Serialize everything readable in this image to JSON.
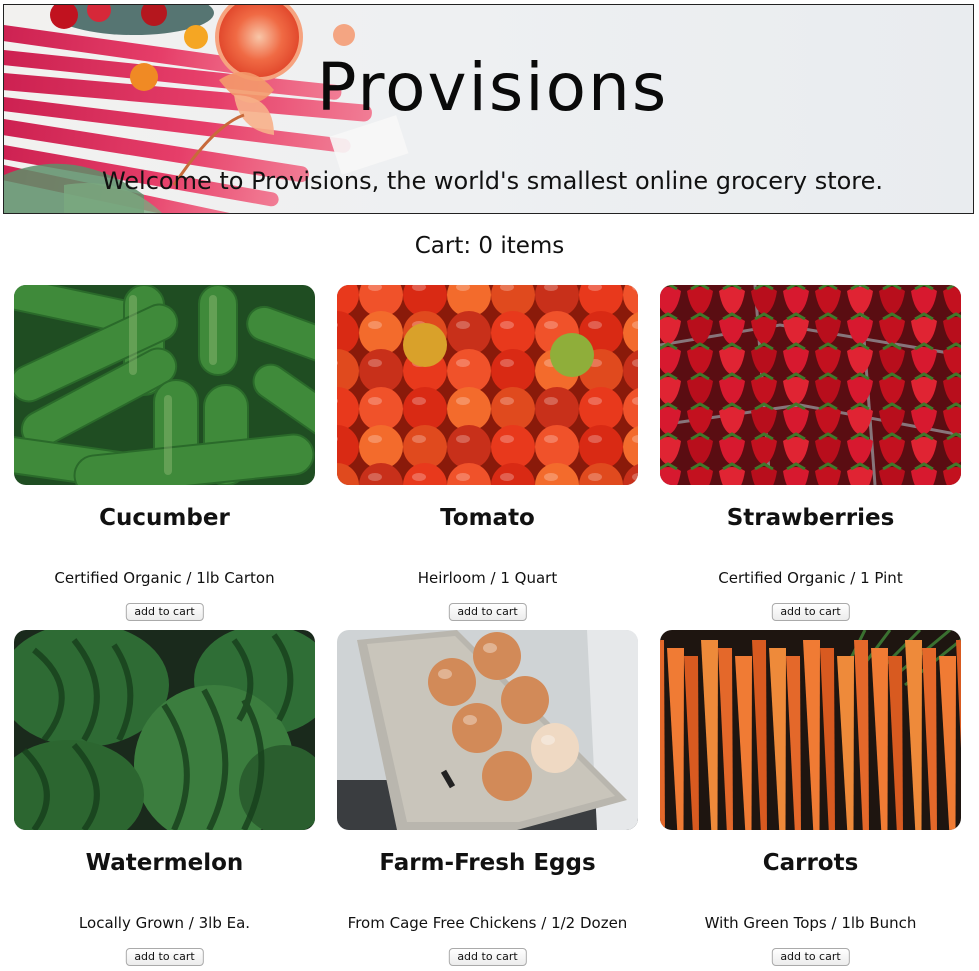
{
  "header": {
    "title": "Provisions",
    "subtitle": "Welcome to Provisions, the world's smallest online grocery store."
  },
  "cart": {
    "text": "Cart: 0 items"
  },
  "products": [
    {
      "name": "Cucumber",
      "description": "Certified Organic / 1lb Carton",
      "button_label": "add to cart",
      "photo": "cucumbers-photo"
    },
    {
      "name": "Tomato",
      "description": "Heirloom / 1 Quart",
      "button_label": "add to cart",
      "photo": "tomatoes-photo"
    },
    {
      "name": "Strawberries",
      "description": "Certified Organic / 1 Pint",
      "button_label": "add to cart",
      "photo": "strawberries-photo"
    },
    {
      "name": "Watermelon",
      "description": "Locally Grown / 3lb Ea.",
      "button_label": "add to cart",
      "photo": "watermelons-photo"
    },
    {
      "name": "Farm-Fresh Eggs",
      "description": "From Cage Free Chickens / 1/2 Dozen",
      "button_label": "add to cart",
      "photo": "eggs-photo"
    },
    {
      "name": "Carrots",
      "description": "With Green Tops / 1lb Bunch",
      "button_label": "add to cart",
      "photo": "carrots-photo"
    }
  ]
}
